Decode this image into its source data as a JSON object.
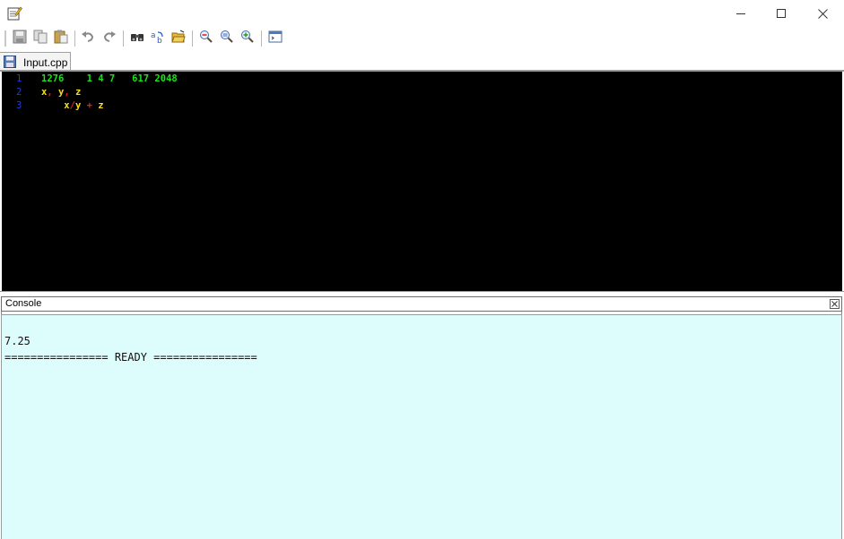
{
  "window": {
    "app_icon": "notepad-pencil-icon",
    "controls": [
      "minimize-icon",
      "maximize-icon",
      "close-icon"
    ]
  },
  "toolbar": {
    "buttons": [
      "save-icon",
      "copy-icon",
      "paste-icon",
      "undo-icon",
      "redo-icon",
      "find-icon",
      "replace-icon",
      "open-folder-icon",
      "zoom-out-icon",
      "zoom-reset-icon",
      "zoom-in-icon",
      "console-window-icon"
    ]
  },
  "tab": {
    "label": "Input.cpp",
    "icon": "save-disk-icon"
  },
  "editor": {
    "lines": [
      {
        "number": "1",
        "parts": [
          {
            "t": "1276    1 4 7   617 2048",
            "c": "num"
          }
        ]
      },
      {
        "number": "2",
        "parts": [
          {
            "t": "x",
            "c": "id"
          },
          {
            "t": ",",
            "c": "punct"
          },
          {
            "t": " y",
            "c": "id"
          },
          {
            "t": ",",
            "c": "punct"
          },
          {
            "t": " z",
            "c": "id"
          }
        ]
      },
      {
        "number": "3",
        "parts": [
          {
            "t": "    x",
            "c": "id"
          },
          {
            "t": "/",
            "c": "op"
          },
          {
            "t": "y ",
            "c": "id"
          },
          {
            "t": "+",
            "c": "op"
          },
          {
            "t": " z",
            "c": "id"
          }
        ]
      }
    ],
    "colors": {
      "line_numbers": "#1c3ce6",
      "numbers": "#19e419",
      "identifiers": "#f6e016",
      "operators": "#e02020",
      "background": "#000000"
    }
  },
  "console": {
    "title": "Console",
    "output": [
      "",
      "7.25",
      "================ READY ================"
    ],
    "background": "#ddfdfd"
  }
}
